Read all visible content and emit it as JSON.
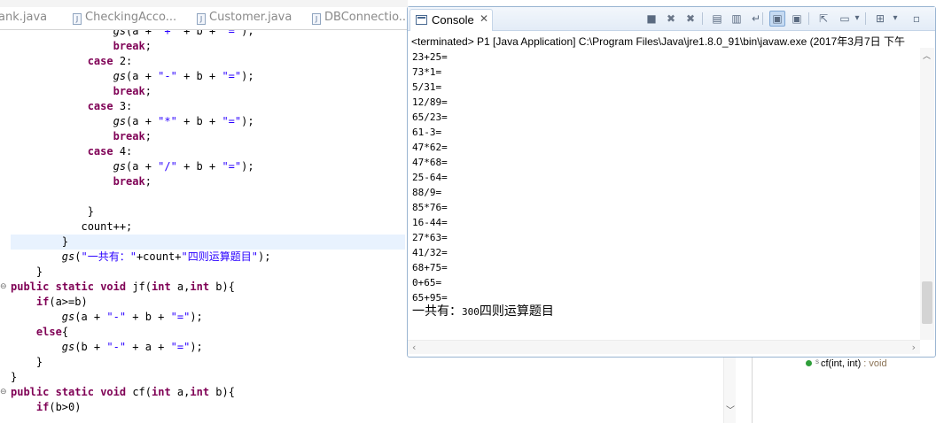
{
  "editor": {
    "tabs": [
      {
        "label": "ank.java",
        "has_icon": false
      },
      {
        "label": "CheckingAcco...",
        "has_icon": true
      },
      {
        "label": "Customer.java",
        "has_icon": true
      },
      {
        "label": "DBConnectio...",
        "has_icon": true
      }
    ],
    "code_lines": [
      "                gs(a + \"+\" + b + \"=\");",
      "                break;",
      "            case 2:",
      "                gs(a + \"-\" + b + \"=\");",
      "                break;",
      "            case 3:",
      "                gs(a + \"*\" + b + \"=\");",
      "                break;",
      "            case 4:",
      "                gs(a + \"/\" + b + \"=\");",
      "                break;",
      "",
      "            }",
      "           count++;",
      "        }",
      "        gs(\"一共有：\"+count+\"四则运算题目\");",
      "    }",
      "public static void jf(int a,int b){",
      "    if(a>=b)",
      "        gs(a + \"-\" + b + \"=\");",
      "    else{",
      "        gs(b + \"-\" + a + \"=\");",
      "    }",
      "}",
      "public static void cf(int a,int b){",
      "    if(b>0)"
    ]
  },
  "console": {
    "tab_label": "Console",
    "tab_close": "✕",
    "status": "<terminated> P1 [Java Application] C:\\Program Files\\Java\\jre1.8.0_91\\bin\\javaw.exe (2017年3月7日 下午",
    "output_lines": [
      "23+25=",
      "73*1=",
      "5/31=",
      "12/89=",
      "65/23=",
      "61-3=",
      "47*62=",
      "47*68=",
      "25-64=",
      "88/9=",
      "85*76=",
      "16-44=",
      "27*63=",
      "41/32=",
      "68+75=",
      "0+65=",
      "65+95="
    ],
    "summary_prefix": "一共有：",
    "summary_count": "300",
    "summary_suffix": "四则运算题目",
    "toolbar": [
      {
        "name": "terminate-button",
        "glyph": "■"
      },
      {
        "name": "remove-launch-button",
        "glyph": "✖"
      },
      {
        "name": "remove-all-terminated-button",
        "glyph": "✖"
      },
      {
        "name": "clear-console-button",
        "glyph": "▤"
      },
      {
        "name": "scroll-lock-button",
        "glyph": "▥"
      },
      {
        "name": "word-wrap-button",
        "glyph": "↵"
      },
      {
        "name": "show-on-stdout-button",
        "glyph": "▣"
      },
      {
        "name": "show-on-stderr-button",
        "glyph": "▣"
      },
      {
        "name": "pin-console-button",
        "glyph": "⇱"
      },
      {
        "name": "display-console-button",
        "glyph": "▭"
      },
      {
        "name": "display-dropdown-button",
        "glyph": "▾"
      },
      {
        "name": "open-console-button",
        "glyph": "⊞"
      },
      {
        "name": "open-console-dropdown-button",
        "glyph": "▾"
      },
      {
        "name": "minimize-button",
        "glyph": "▫"
      }
    ]
  },
  "outline": {
    "method_name": "cf(int, int)",
    "return_type": ": void",
    "modifier": "s"
  }
}
